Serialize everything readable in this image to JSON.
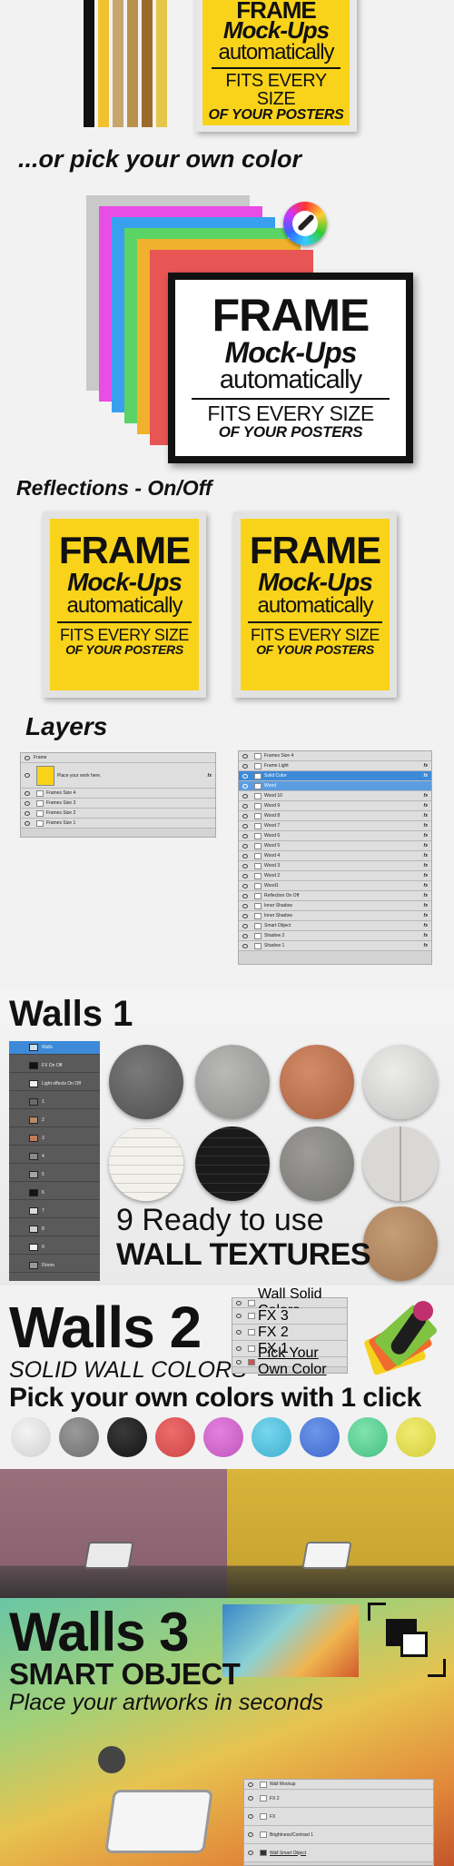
{
  "poster": {
    "line1": "FRAME",
    "line2": "Mock-Ups",
    "line3": "automatically",
    "line4": "FITS EVERY SIZE",
    "line5": "OF YOUR POSTERS"
  },
  "sections": {
    "own_color": "...or pick your own color",
    "reflections": "Reflections - On/Off",
    "layers": "Layers",
    "walls1": "Walls 1",
    "walls1_tagline_1": "9 Ready to use",
    "walls1_tagline_2": "WALL TEXTURES",
    "walls2": "Walls 2",
    "walls2_sub": "SOLID WALL COLORS",
    "walls2_pick": "Pick your own colors with 1 click",
    "walls3": "Walls 3",
    "walls3_sub": "SMART OBJECT",
    "walls3_place": "Place your artworks in seconds"
  },
  "layers_left": [
    {
      "name": "Frame",
      "fx": false
    },
    {
      "name": "Place your work here.",
      "fx": true
    },
    {
      "name": "Frames Size 4",
      "fx": false
    },
    {
      "name": "Frames Size 3",
      "fx": false
    },
    {
      "name": "Frames Size 2",
      "fx": false
    },
    {
      "name": "Frames Size 1",
      "fx": false
    }
  ],
  "layers_right": [
    {
      "name": "Frames Size 4"
    },
    {
      "name": "Frame Light"
    },
    {
      "name": "Solid Color"
    },
    {
      "name": "Wood"
    },
    {
      "name": "Wood 10"
    },
    {
      "name": "Wood 9"
    },
    {
      "name": "Wood 8"
    },
    {
      "name": "Wood 7"
    },
    {
      "name": "Wood 6"
    },
    {
      "name": "Wood 5"
    },
    {
      "name": "Wood 4"
    },
    {
      "name": "Wood 3"
    },
    {
      "name": "Wood 2"
    },
    {
      "name": "Wood1"
    },
    {
      "name": "Reflection On Off"
    },
    {
      "name": "Inner Shadow"
    },
    {
      "name": "Inner Shadow"
    },
    {
      "name": "Smart Object"
    },
    {
      "name": "Shadow 2"
    },
    {
      "name": "Shadow 1"
    }
  ],
  "walls1_layers": [
    "Walls",
    "FX On Off",
    "Light effects On Off",
    "1",
    "2",
    "3",
    "4",
    "5",
    "6",
    "7",
    "8",
    "9",
    "Floors"
  ],
  "walls2_layers": [
    "Wall Solid Colors",
    "FX 3",
    "FX 2",
    "FX 1",
    "Pick Your Own Color"
  ],
  "walls3_layers": [
    "Wall Mockup",
    "FX 2",
    "FX",
    "Brightness/Contrast 1",
    "Wall Smart Object"
  ],
  "colors": {
    "frames": [
      "#111111",
      "#f2c12e",
      "#c7a56c",
      "#b9914a",
      "#9c6b2c",
      "#e4c64a"
    ],
    "stack": [
      "#c9c9c9",
      "#e84de6",
      "#39a0f0",
      "#5bd465",
      "#f0b12d",
      "#e85555",
      "#9bd4f5"
    ],
    "textures": [
      "#6a6a6a",
      "#a5a5a3",
      "#c27a5a",
      "#d9d9d7",
      "#f0efe9",
      "#141414",
      "#8b8a87",
      "#cfceca",
      "#b58c66"
    ],
    "solid": [
      "#e6e6e6",
      "#8a8a8a",
      "#2a2a2a",
      "#e35b5b",
      "#d66bd2",
      "#57c8e4",
      "#4f7fe0",
      "#63d79b",
      "#e9e35a"
    ],
    "wall_left": "#9a6f7c",
    "wall_right": "#d8b43c"
  }
}
